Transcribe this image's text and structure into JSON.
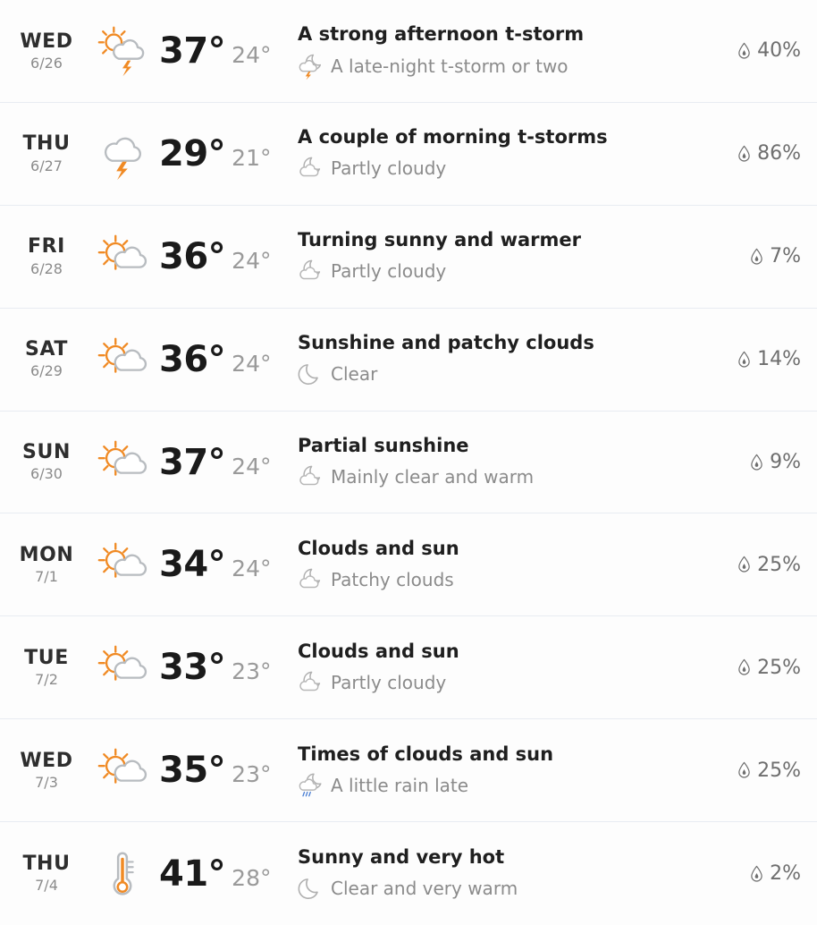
{
  "colors": {
    "sun": "#F08A24",
    "cloud": "#B8BCC0",
    "bolt": "#F08A24",
    "rain": "#4a7fd4",
    "moon": "#9b9b9b",
    "row_separator": "#e8ecf2",
    "high_temp": "#1a1a1a",
    "low_temp": "#9a9a9a",
    "desc_day": "#1f1f1f",
    "desc_night": "#8b8b8b",
    "precip": "#6e6e6e",
    "background": "#fdfdfd"
  },
  "icons": {
    "precip_drop": "water-drop-icon",
    "day_icons": [
      "sun-cloud-thunderstorm-icon",
      "cloud-thunderstorm-icon",
      "sun-cloud-icon",
      "sun-cloud-icon",
      "sun-cloud-icon",
      "sun-cloud-icon",
      "sun-cloud-icon",
      "sun-cloud-icon",
      "thermometer-hot-icon"
    ],
    "night_icons": [
      "moon-cloud-thunderstorm-icon",
      "moon-cloud-icon",
      "moon-cloud-icon",
      "moon-clear-icon",
      "moon-cloud-icon",
      "moon-cloud-icon",
      "moon-cloud-icon",
      "moon-cloud-rain-icon",
      "moon-clear-icon"
    ]
  },
  "forecast": {
    "units": "°",
    "rows": [
      {
        "day": "WED",
        "date": "6/26",
        "high": "37°",
        "low": "24°",
        "day_desc": "A strong afternoon t-storm",
        "night_desc": "A late-night t-storm or two",
        "precip": "40%",
        "day_icon": "sun-cloud-thunderstorm-icon",
        "night_icon": "moon-cloud-thunderstorm-icon"
      },
      {
        "day": "THU",
        "date": "6/27",
        "high": "29°",
        "low": "21°",
        "day_desc": "A couple of morning t-storms",
        "night_desc": "Partly cloudy",
        "precip": "86%",
        "day_icon": "cloud-thunderstorm-icon",
        "night_icon": "moon-cloud-icon"
      },
      {
        "day": "FRI",
        "date": "6/28",
        "high": "36°",
        "low": "24°",
        "day_desc": "Turning sunny and warmer",
        "night_desc": "Partly cloudy",
        "precip": "7%",
        "day_icon": "sun-cloud-icon",
        "night_icon": "moon-cloud-icon"
      },
      {
        "day": "SAT",
        "date": "6/29",
        "high": "36°",
        "low": "24°",
        "day_desc": "Sunshine and patchy clouds",
        "night_desc": "Clear",
        "precip": "14%",
        "day_icon": "sun-cloud-icon",
        "night_icon": "moon-clear-icon"
      },
      {
        "day": "SUN",
        "date": "6/30",
        "high": "37°",
        "low": "24°",
        "day_desc": "Partial sunshine",
        "night_desc": "Mainly clear and warm",
        "precip": "9%",
        "day_icon": "sun-cloud-icon",
        "night_icon": "moon-cloud-icon"
      },
      {
        "day": "MON",
        "date": "7/1",
        "high": "34°",
        "low": "24°",
        "day_desc": "Clouds and sun",
        "night_desc": "Patchy clouds",
        "precip": "25%",
        "day_icon": "sun-cloud-icon",
        "night_icon": "moon-cloud-icon"
      },
      {
        "day": "TUE",
        "date": "7/2",
        "high": "33°",
        "low": "23°",
        "day_desc": "Clouds and sun",
        "night_desc": "Partly cloudy",
        "precip": "25%",
        "day_icon": "sun-cloud-icon",
        "night_icon": "moon-cloud-icon"
      },
      {
        "day": "WED",
        "date": "7/3",
        "high": "35°",
        "low": "23°",
        "day_desc": "Times of clouds and sun",
        "night_desc": "A little rain late",
        "precip": "25%",
        "day_icon": "sun-cloud-icon",
        "night_icon": "moon-cloud-rain-icon"
      },
      {
        "day": "THU",
        "date": "7/4",
        "high": "41°",
        "low": "28°",
        "day_desc": "Sunny and very hot",
        "night_desc": "Clear and very warm",
        "precip": "2%",
        "day_icon": "thermometer-hot-icon",
        "night_icon": "moon-clear-icon"
      }
    ]
  }
}
